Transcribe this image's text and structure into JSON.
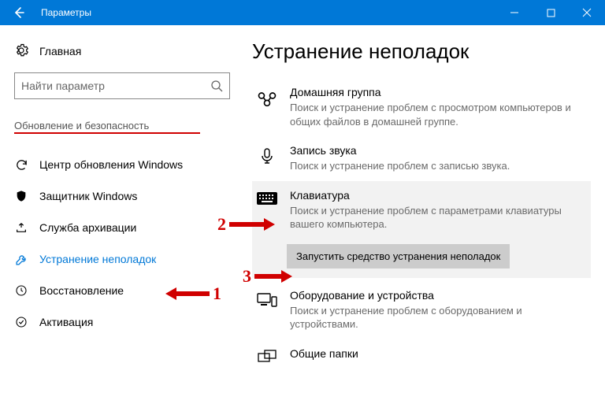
{
  "window": {
    "title": "Параметры"
  },
  "sidebar": {
    "home": "Главная",
    "search_placeholder": "Найти параметр",
    "section": "Обновление и безопасность",
    "items": [
      {
        "label": "Центр обновления Windows"
      },
      {
        "label": "Защитник Windows"
      },
      {
        "label": "Служба архивации"
      },
      {
        "label": "Устранение неполадок"
      },
      {
        "label": "Восстановление"
      },
      {
        "label": "Активация"
      }
    ]
  },
  "main": {
    "title": "Устранение неполадок",
    "items": [
      {
        "h": "Домашняя группа",
        "d": "Поиск и устранение проблем с просмотром компьютеров и общих файлов в домашней группе."
      },
      {
        "h": "Запись звука",
        "d": "Поиск и устранение проблем с записью звука."
      },
      {
        "h": "Клавиатура",
        "d": "Поиск и устранение проблем с параметрами клавиатуры вашего компьютера."
      },
      {
        "h": "Оборудование и устройства",
        "d": "Поиск и устранение проблем с оборудованием и устройствами."
      },
      {
        "h": "Общие папки",
        "d": ""
      }
    ],
    "run_button": "Запустить средство устранения неполадок"
  },
  "annotations": {
    "n1": "1",
    "n2": "2",
    "n3": "3"
  }
}
